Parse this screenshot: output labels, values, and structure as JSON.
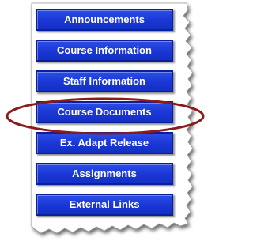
{
  "menu": {
    "items": [
      {
        "label": "Announcements"
      },
      {
        "label": "Course Information"
      },
      {
        "label": "Staff Information"
      },
      {
        "label": "Course Documents"
      },
      {
        "label": "Ex. Adapt Release"
      },
      {
        "label": "Assignments"
      },
      {
        "label": "External Links"
      }
    ],
    "highlighted_item": "Course Documents"
  },
  "colors": {
    "button_fill": "#1a36d4",
    "button_border": "#0b1f9a",
    "button_text": "#ffffff",
    "highlight_ellipse": "#8b1a1a",
    "paper": "#ffffff"
  }
}
